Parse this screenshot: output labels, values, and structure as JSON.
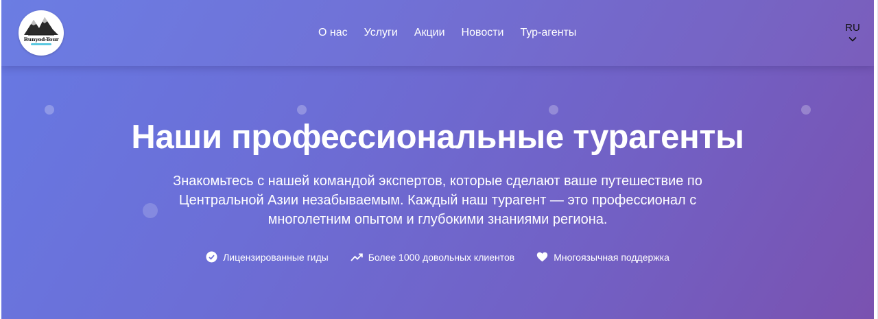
{
  "brand": {
    "logo_text": "Bunyod-Tour"
  },
  "nav": {
    "items": [
      {
        "label": "О нас"
      },
      {
        "label": "Услуги"
      },
      {
        "label": "Акции"
      },
      {
        "label": "Новости"
      },
      {
        "label": "Тур-агенты"
      }
    ]
  },
  "language": {
    "current": "RU",
    "icon": "chevron-down-icon"
  },
  "hero": {
    "title": "Наши профессиональные турагенты",
    "subtitle": "Знакомьтесь с нашей командой экспертов, которые сделают ваше путешествие по Центральной Азии незабываемым. Каждый наш турагент — это профессионал с многолетним опытом и глубокими знаниями региона.",
    "features": [
      {
        "icon": "check-badge-icon",
        "label": "Лицензированные гиды"
      },
      {
        "icon": "trend-up-icon",
        "label": "Более 1000 довольных клиентов"
      },
      {
        "icon": "heart-icon",
        "label": "Многоязычная поддержка"
      }
    ]
  },
  "colors": {
    "gradient_start": "#6779e3",
    "gradient_end": "#7a52b0",
    "text_light": "#ffffff"
  }
}
